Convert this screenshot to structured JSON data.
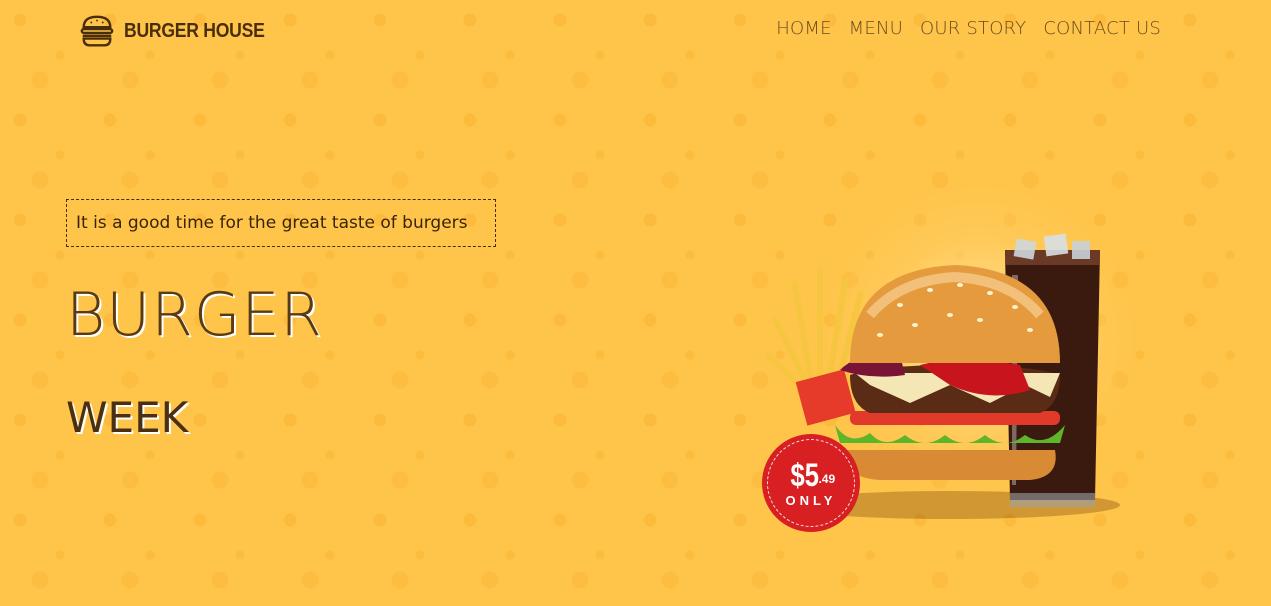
{
  "brand": {
    "name": "BURGER HOUSE",
    "icon": "burger-icon"
  },
  "nav": {
    "items": [
      {
        "label": "HOME"
      },
      {
        "label": "MENU"
      },
      {
        "label": "OUR STORY"
      },
      {
        "label": "CONTACT US"
      }
    ]
  },
  "hero": {
    "tagline": "It is a good time for the great taste of burgers",
    "title": "BURGER",
    "subtitle": "WEEK",
    "price": {
      "dollars": "$5",
      "cents": ".49",
      "note": "ONLY"
    }
  },
  "colors": {
    "background": "#ffc44a",
    "text_dark": "#4a2e0c",
    "badge": "#d81f22"
  }
}
